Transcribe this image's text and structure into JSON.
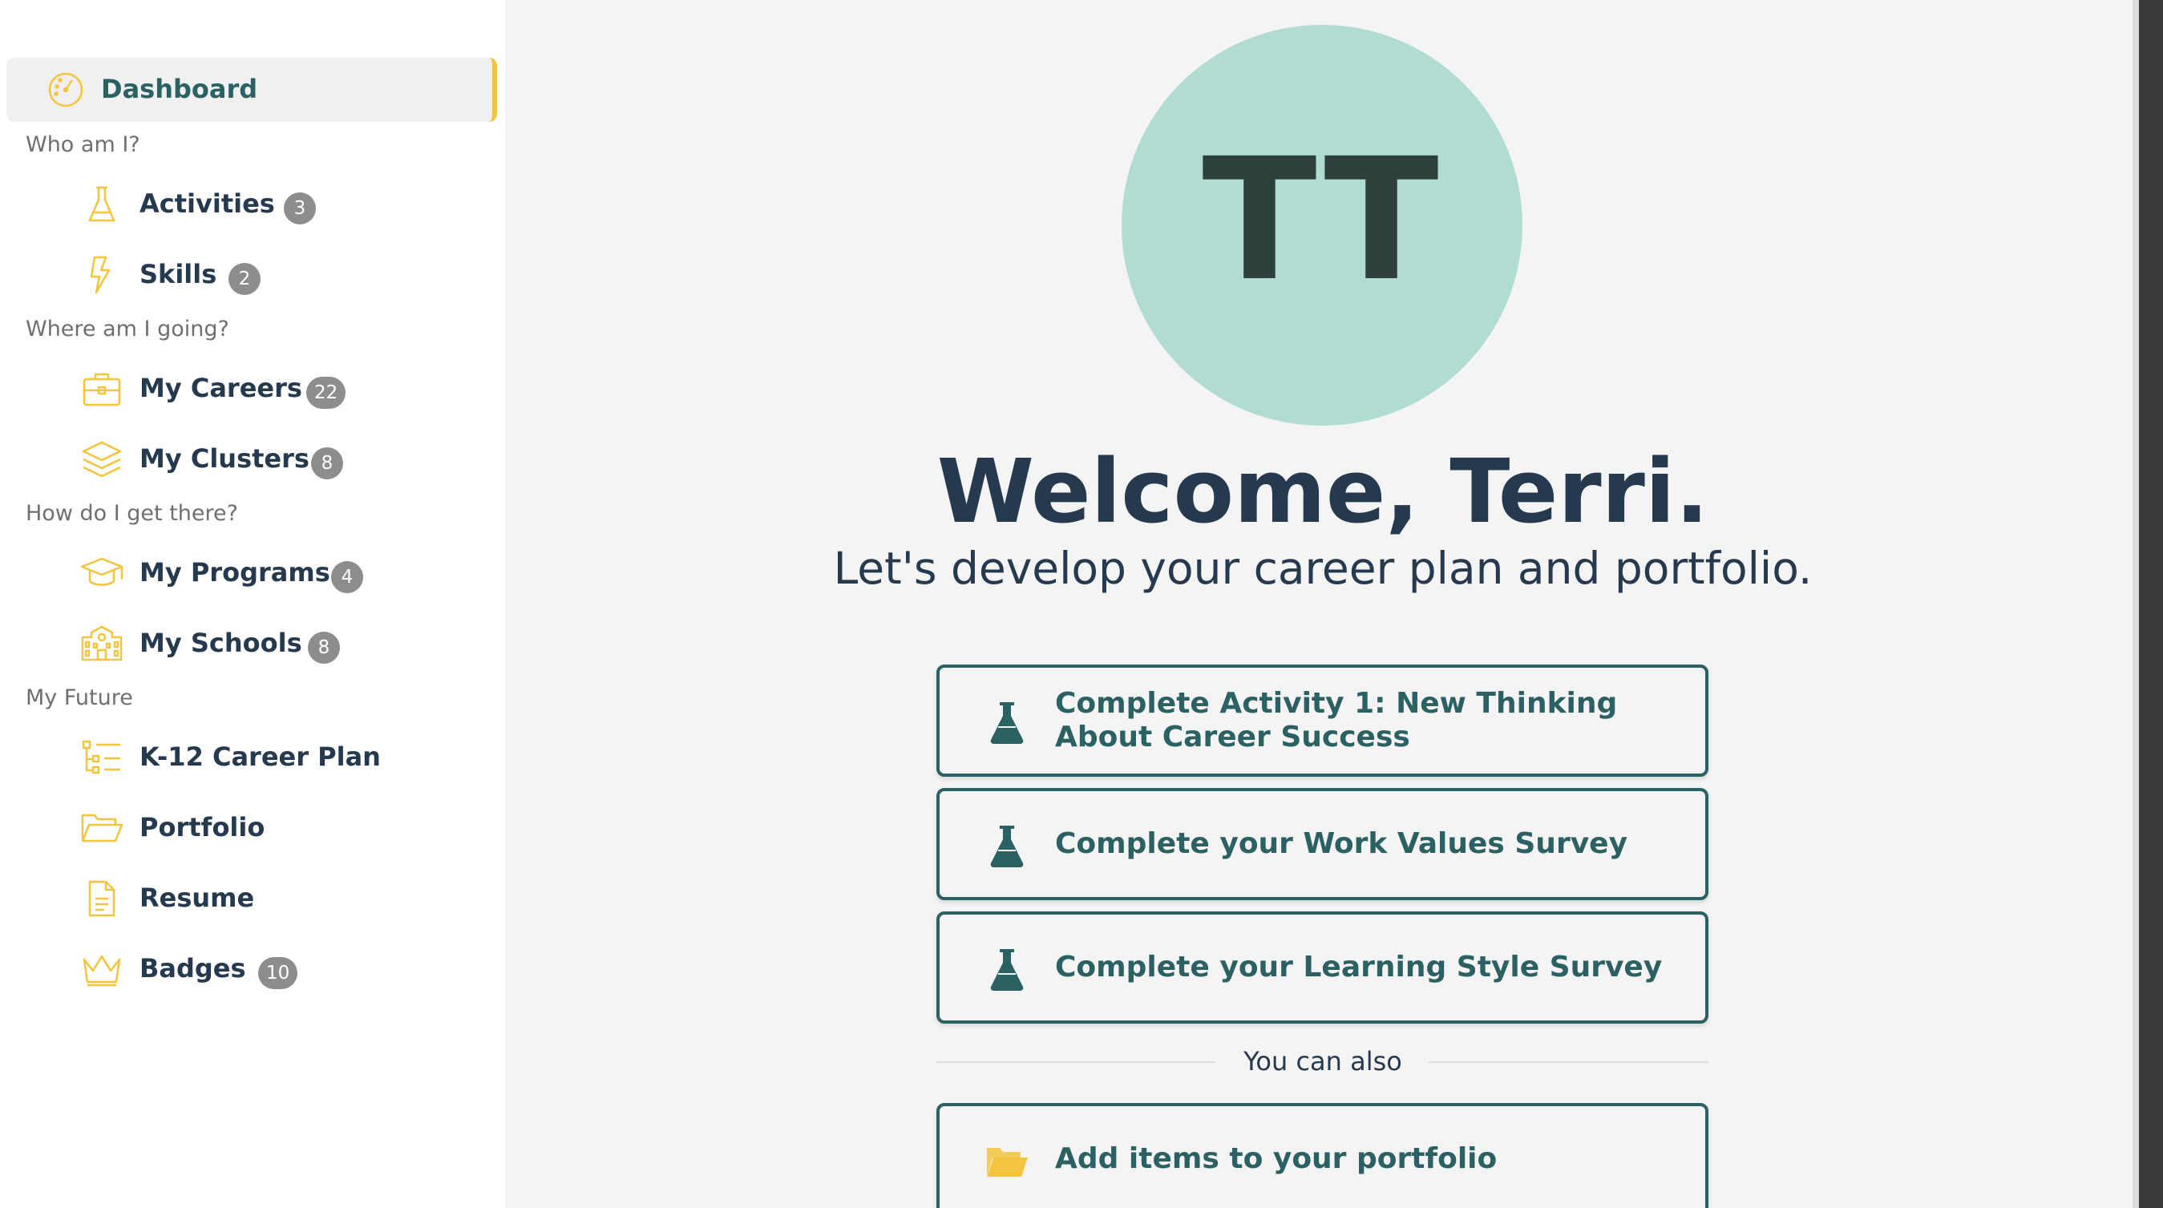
{
  "sidebar": {
    "active": {
      "label": "Dashboard",
      "icon": "gauge-icon"
    },
    "sections": [
      {
        "label": "Who am I?"
      },
      {
        "label": "Where am I going?"
      },
      {
        "label": "How do I get there?"
      },
      {
        "label": "My Future"
      }
    ],
    "items": [
      {
        "label": "Activities",
        "badge": "3",
        "icon": "flask-icon"
      },
      {
        "label": "Skills",
        "badge": "2",
        "icon": "lightning-icon"
      },
      {
        "label": "My Careers",
        "badge": "22",
        "icon": "briefcase-icon"
      },
      {
        "label": "My Clusters",
        "badge": "8",
        "icon": "layers-icon"
      },
      {
        "label": "My Programs",
        "badge": "4",
        "icon": "graduation-cap-icon"
      },
      {
        "label": "My Schools",
        "badge": "8",
        "icon": "school-icon"
      },
      {
        "label": "K-12 Career Plan",
        "icon": "plan-list-icon"
      },
      {
        "label": "Portfolio",
        "icon": "folder-icon"
      },
      {
        "label": "Resume",
        "icon": "document-icon"
      },
      {
        "label": "Badges",
        "badge": "10",
        "icon": "crown-icon"
      }
    ],
    "accent_color": "#f3c43d"
  },
  "main": {
    "avatar_initials": "TT",
    "avatar_color": "#b0dcd2",
    "welcome": "Welcome, Terri.",
    "subtitle": "Let's develop your career plan and portfolio.",
    "actions": [
      {
        "label": "Complete Activity 1: New Thinking About Career Success",
        "icon": "flask-icon"
      },
      {
        "label": "Complete your Work Values Survey",
        "icon": "flask-icon"
      },
      {
        "label": "Complete your Learning Style Survey",
        "icon": "flask-icon"
      }
    ],
    "divider_text": "You can also",
    "extra_actions": [
      {
        "label": "Add items to your portfolio",
        "icon": "folder-open-icon"
      }
    ],
    "accent_color": "#2c6164"
  }
}
